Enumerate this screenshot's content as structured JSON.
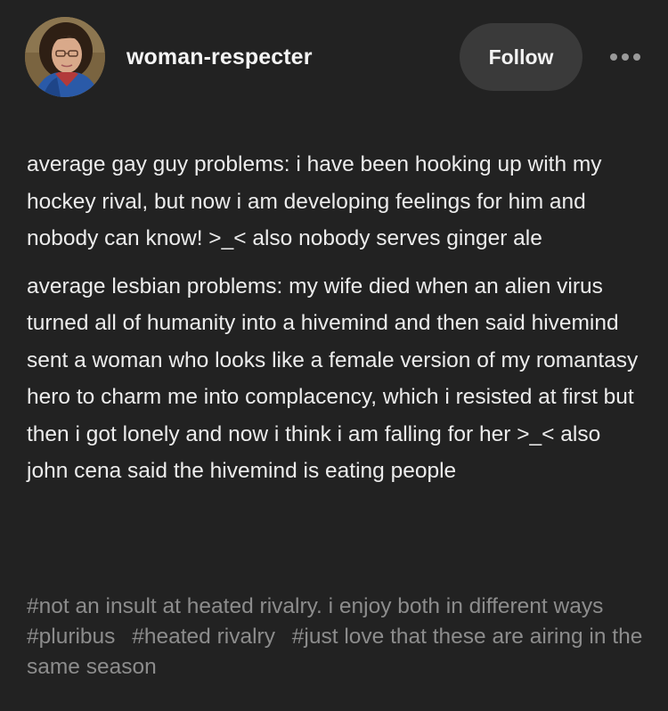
{
  "post": {
    "author": {
      "username": "woman-respecter",
      "avatar": "profile-photo"
    },
    "follow_label": "Follow",
    "more_icon": "ellipsis-icon",
    "paragraphs": [
      "average gay guy problems: i have been hooking up with my hockey rival, but now i am developing feelings for him and nobody can know! >_< also nobody serves ginger ale",
      "average lesbian problems: my wife died when an alien virus turned all of humanity into a hivemind and then said hivemind sent a woman who looks like a female version of my romantasy hero to charm me into complacency, which i resisted at first but then i got lonely and now i think i am falling for her >_< also john cena said the hivemind is eating people"
    ],
    "tags": [
      "#not an insult at heated rivalry. i enjoy both in different ways",
      "#pluribus",
      "#heated rivalry",
      "#just love that these are airing in the same season"
    ]
  },
  "colors": {
    "background": "#222222",
    "text": "#ececec",
    "tag_text": "#8c8c8c",
    "follow_bg": "#3a3a3a"
  }
}
